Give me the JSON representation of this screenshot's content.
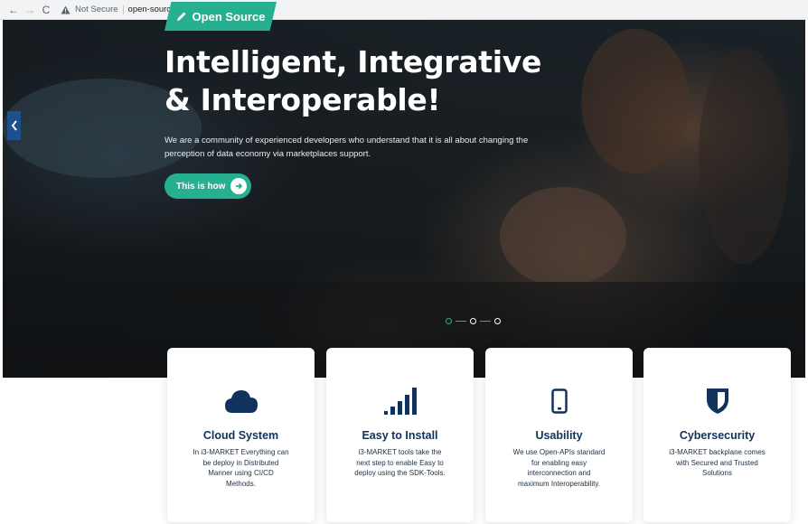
{
  "browser": {
    "not_secure": "Not Secure",
    "url": "open-source.i3-market.eu"
  },
  "hero": {
    "badge": "Open Source",
    "headline_line1": "Intelligent, Integrative",
    "headline_line2": "& Interoperable!",
    "subtext_line1": "We are a community of experienced developers who understand that it is all about changing the",
    "subtext_line2": "perception of data economy via marketplaces support.",
    "cta_label": "This is how"
  },
  "features": [
    {
      "icon": "cloud-icon",
      "title": "Cloud System",
      "desc_lines": [
        "In i3-MARKET Everything can",
        "be deploy in Distributed",
        "Manner using CI/CD",
        "Methods."
      ]
    },
    {
      "icon": "signal-bars-icon",
      "title": "Easy to Install",
      "desc_lines": [
        "i3-MARKET tools take the",
        "next step to enable Easy to",
        "deploy using the SDK-Tools."
      ]
    },
    {
      "icon": "mobile-icon",
      "title": "Usability",
      "desc_lines": [
        "We use Open-APIs standard",
        "for enabling easy",
        "interconnection and",
        "maximum Interoperability."
      ]
    },
    {
      "icon": "shield-icon",
      "title": "Cybersecurity",
      "desc_lines": [
        "i3-MARKET backplane comes",
        "with Secured and Trusted",
        "Solutions"
      ]
    }
  ],
  "colors": {
    "accent": "#27b08f",
    "title": "#10325c",
    "arrow_bg": "#1c4f8c"
  }
}
